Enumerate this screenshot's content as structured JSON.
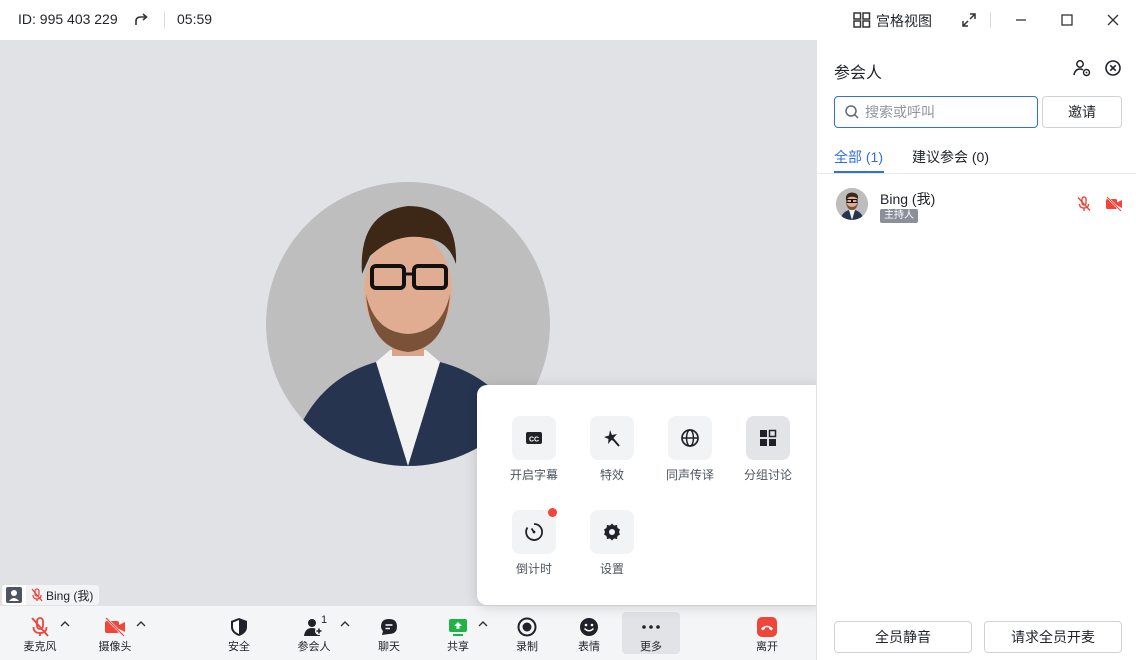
{
  "titlebar": {
    "meeting_id": "ID: 995 403 229",
    "timer": "05:59",
    "view_label": "宫格视图"
  },
  "stage": {
    "name_tag": "Bing (我)"
  },
  "toolbar": {
    "mic": "麦克风",
    "camera": "摄像头",
    "security": "安全",
    "participants": "参会人",
    "participants_count": "1",
    "chat": "聊天",
    "share": "共享",
    "record": "录制",
    "reactions": "表情",
    "more": "更多",
    "leave": "离开"
  },
  "more_menu": {
    "items": [
      {
        "label": "开启字幕",
        "icon": "cc-icon"
      },
      {
        "label": "特效",
        "icon": "effects-icon"
      },
      {
        "label": "同声传译",
        "icon": "globe-icon"
      },
      {
        "label": "分组讨论",
        "icon": "breakout-icon"
      },
      {
        "label": "倒计时",
        "icon": "timer-icon"
      },
      {
        "label": "设置",
        "icon": "gear-icon"
      }
    ]
  },
  "panel": {
    "title": "参会人",
    "search_placeholder": "搜索或呼叫",
    "invite": "邀请",
    "tabs": [
      {
        "label": "全部 (1)",
        "active": true
      },
      {
        "label": "建议参会 (0)",
        "active": false
      }
    ],
    "members": [
      {
        "name": "Bing (我)",
        "role": "主持人",
        "mic": "muted",
        "camera": "off"
      }
    ],
    "mute_all": "全员静音",
    "unmute_all": "请求全员开麦"
  },
  "colors": {
    "accent": "#2f6ee8",
    "danger": "#f0453a",
    "share_green": "#1fb346",
    "stage_bg": "#e1e2e6"
  }
}
